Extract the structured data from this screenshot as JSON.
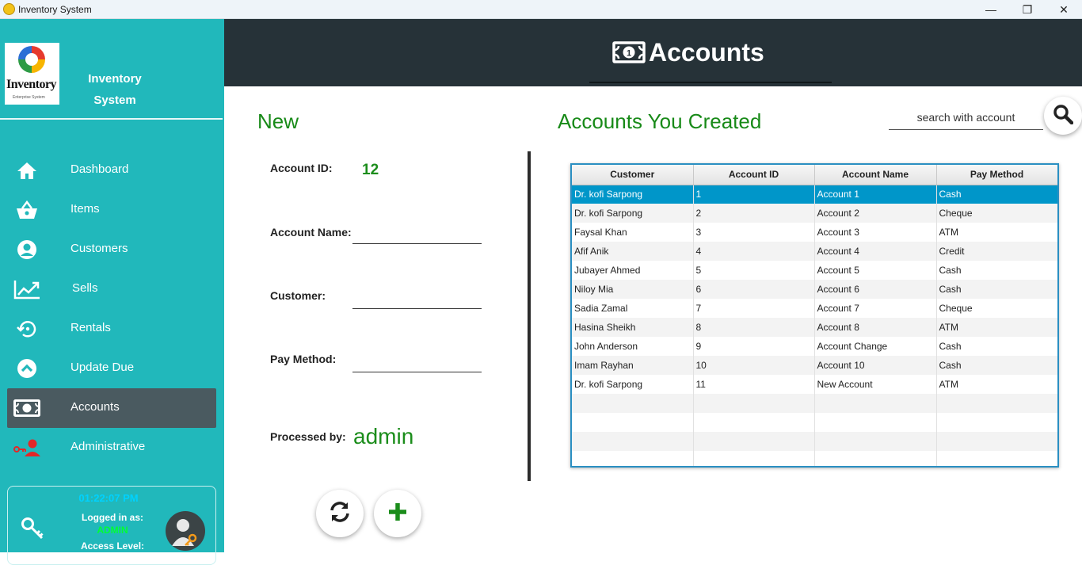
{
  "window": {
    "title": "Inventory System",
    "minimize": "—",
    "maximize": "❐",
    "close": "✕"
  },
  "sidebar": {
    "logo_text": "Inventory",
    "logo_sub": "Enterprise System",
    "app_name_line1": "Inventory",
    "app_name_line2": "System",
    "items": [
      {
        "label": "Dashboard",
        "icon": "home-icon",
        "active": false
      },
      {
        "label": "Items",
        "icon": "basket-icon",
        "active": false
      },
      {
        "label": "Customers",
        "icon": "user-circle-icon",
        "active": false
      },
      {
        "label": "Sells",
        "icon": "chart-line-icon",
        "active": false
      },
      {
        "label": "Rentals",
        "icon": "history-icon",
        "active": false
      },
      {
        "label": "Update Due",
        "icon": "chevron-up-circle-icon",
        "active": false
      },
      {
        "label": "Accounts",
        "icon": "money-bill-icon",
        "active": true
      },
      {
        "label": "Administrative",
        "icon": "user-key-icon",
        "active": false
      }
    ],
    "status": {
      "time": "01:22:07 PM",
      "logged_in_label": "Logged in as:",
      "user": "ADMIN",
      "access_label": "Access Level:"
    }
  },
  "header": {
    "title": "Accounts"
  },
  "form": {
    "section_title": "New",
    "account_id_label": "Account ID:",
    "account_id_value": "12",
    "account_name_label": "Account Name:",
    "account_name_value": "",
    "customer_label": "Customer:",
    "customer_value": "",
    "pay_method_label": "Pay Method:",
    "pay_method_value": "",
    "processed_by_label": "Processed by:",
    "processed_by_value": "admin"
  },
  "list": {
    "section_title": "Accounts You Created",
    "search_placeholder": "search with account",
    "columns": [
      "Customer",
      "Account ID",
      "Account Name",
      "Pay Method"
    ],
    "rows": [
      [
        "Dr. kofi Sarpong",
        "1",
        "Account 1",
        "Cash"
      ],
      [
        "Dr. kofi Sarpong",
        "2",
        "Account 2",
        "Cheque"
      ],
      [
        "Faysal Khan",
        "3",
        "Account 3",
        "ATM"
      ],
      [
        "Afif Anik",
        "4",
        "Account 4",
        "Credit"
      ],
      [
        "Jubayer Ahmed",
        "5",
        "Account 5",
        "Cash"
      ],
      [
        "Niloy Mia",
        "6",
        "Account 6",
        "Cash"
      ],
      [
        "Sadia Zamal",
        "7",
        "Account 7",
        "Cheque"
      ],
      [
        "Hasina Sheikh",
        "8",
        "Account 8",
        "ATM"
      ],
      [
        "John Anderson",
        "9",
        "Account Change",
        "Cash"
      ],
      [
        "Imam Rayhan",
        "10",
        "Account 10",
        "Cash"
      ],
      [
        "Dr. kofi Sarpong",
        "11",
        "New Account",
        "ATM"
      ]
    ],
    "selected_row": 0,
    "empty_rows": 4
  },
  "colors": {
    "sidebar": "#21b8bb",
    "header": "#263238",
    "accent_green": "#188a18",
    "selection": "#0096c9"
  }
}
